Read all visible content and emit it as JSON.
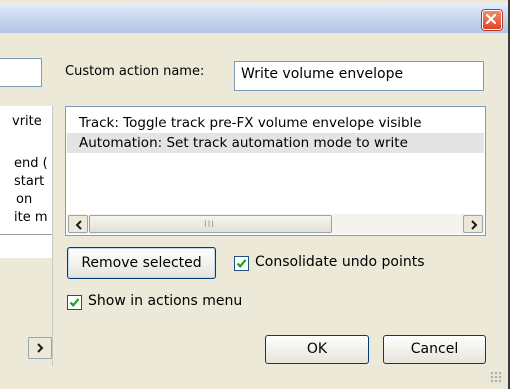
{
  "window": {
    "close_icon": "close-icon"
  },
  "left_panel": {
    "list_fragments": [
      "vrite",
      "end (",
      "start",
      "on",
      "ite m"
    ],
    "scroll_right_icon": "chevron-right-icon"
  },
  "form": {
    "name_label": "Custom action name:",
    "name_value": "Write volume envelope"
  },
  "action_list": {
    "items": [
      "Track: Toggle track pre-FX volume envelope visible",
      "Automation: Set track automation mode to write"
    ],
    "selected_index": 1,
    "scrollbar_grip": "III"
  },
  "buttons": {
    "remove_selected": "Remove selected",
    "ok": "OK",
    "cancel": "Cancel"
  },
  "options": {
    "consolidate_label": "Consolidate undo points",
    "consolidate_checked": true,
    "show_menu_label": "Show in actions menu",
    "show_menu_checked": true
  },
  "colors": {
    "dialog_bg": "#ece9d8",
    "close_red": "#e0442a",
    "selection": "#e4e4e4",
    "button_border": "#003c74",
    "check_green": "#21a121"
  }
}
